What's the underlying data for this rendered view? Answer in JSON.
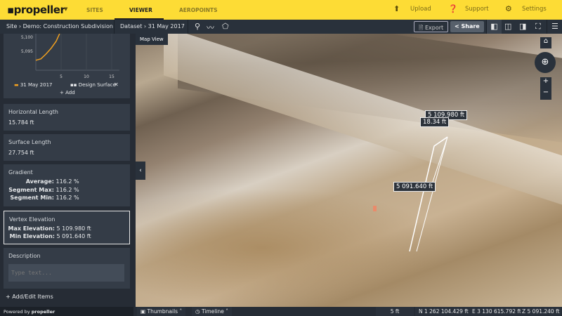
{
  "topbar": {
    "logo": "propeller",
    "nav": [
      "SITES",
      "VIEWER",
      "AEROPOINTS"
    ],
    "active": "VIEWER",
    "upload": "Upload",
    "support": "Support",
    "settings": "Settings"
  },
  "toolbar": {
    "site_crumb": "Site › Demo: Construction Subdivision",
    "dataset_crumb": "Dataset › 31 May 2017",
    "export": "Export",
    "share": "Share",
    "icons": [
      "location-pin-icon",
      "polyline-icon",
      "polygon-icon",
      "split-view-icon",
      "compare-icon",
      "side-panel-icon",
      "fullscreen-icon",
      "sliders-icon"
    ]
  },
  "chart_data": {
    "type": "line",
    "y_ticks": [
      "5,100",
      "5,095"
    ],
    "x_ticks": [
      "5",
      "10",
      "15"
    ],
    "xlim": [
      0,
      17
    ],
    "ylim": [
      5090,
      5102
    ],
    "series": [
      {
        "name": "31 May 2017",
        "color": "#f0a020",
        "x": [
          0,
          1,
          2,
          3,
          4,
          4.7
        ],
        "y": [
          5091.8,
          5092.3,
          5094,
          5096,
          5098.5,
          5101.3
        ]
      }
    ],
    "legend": [
      "31 May 2017",
      "Design Surface"
    ],
    "add": "+ Add"
  },
  "panel": {
    "horizontal_length": {
      "title": "Horizontal Length",
      "value": "15.784 ft"
    },
    "surface_length": {
      "title": "Surface Length",
      "value": "27.754 ft"
    },
    "gradient": {
      "title": "Gradient",
      "rows": [
        {
          "k": "Average:",
          "v": "116.2 %"
        },
        {
          "k": "Segment Max:",
          "v": "116.2 %"
        },
        {
          "k": "Segment Min:",
          "v": "116.2 %"
        }
      ]
    },
    "vertex": {
      "title": "Vertex Elevation",
      "rows": [
        {
          "k": "Max Elevation:",
          "v": "5 109.980 ft"
        },
        {
          "k": "Min Elevation:",
          "v": "5 091.640 ft"
        }
      ]
    },
    "description": {
      "title": "Description",
      "placeholder": "Type text..."
    },
    "add_edit": "+ Add/Edit Items",
    "powered_by": "Powered by",
    "powered_logo": "propeller"
  },
  "map": {
    "tab": "Map View",
    "labels": {
      "max": "5 109.980 ft",
      "length": "18.34 ft",
      "min": "5 091.640 ft"
    }
  },
  "bottom": {
    "thumbnails": "Thumbnails",
    "timeline": "Timeline",
    "scale": "5 ft",
    "north": "N 1 262 104.429 ft",
    "east": "E 3 130 615.792 ft",
    "z": "Z 5 091.240 ft"
  }
}
